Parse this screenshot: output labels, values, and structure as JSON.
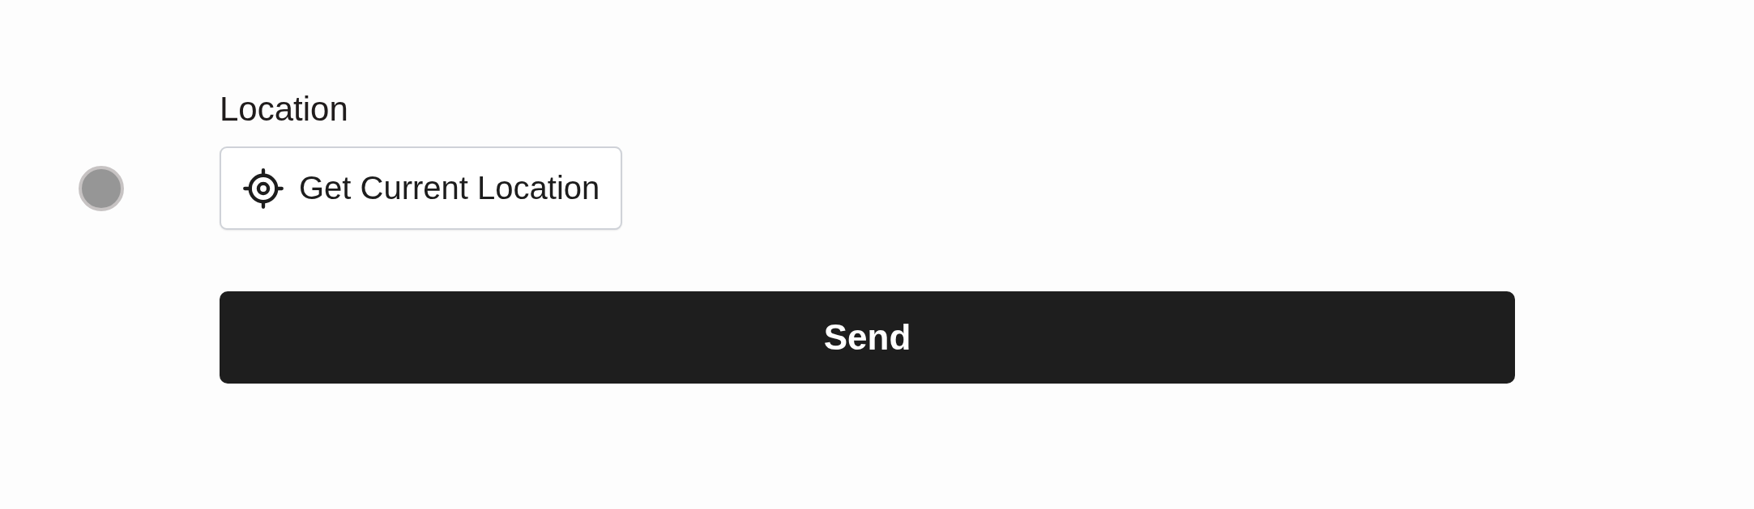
{
  "location_field": {
    "label": "Location",
    "button": "Get Current Location"
  },
  "submit_button": {
    "label": "Send"
  }
}
